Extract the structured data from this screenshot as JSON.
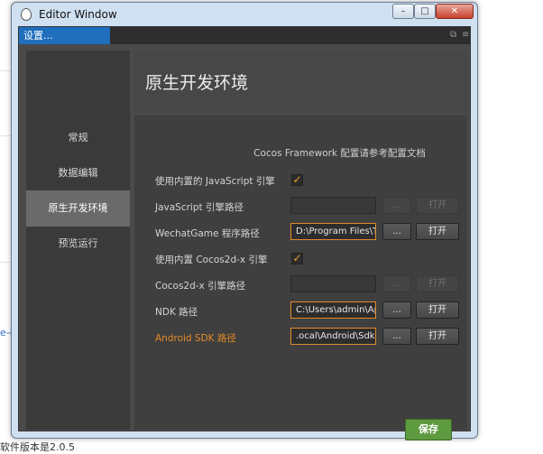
{
  "window": {
    "title": "Editor Window",
    "controls": {
      "minimize": "–",
      "maximize": "□",
      "close": "✕"
    }
  },
  "tab": {
    "label": "设置..."
  },
  "sidebar": {
    "items": [
      {
        "label": "常规",
        "active": false
      },
      {
        "label": "数据编辑",
        "active": false
      },
      {
        "label": "原生开发环境",
        "active": true
      },
      {
        "label": "预览运行",
        "active": false
      }
    ]
  },
  "main": {
    "title": "原生开发环境",
    "framework_note": "Cocos Framework 配置请参考配置文档",
    "rows": {
      "use_builtin_js": {
        "label": "使用内置的 JavaScript 引擎",
        "checked": true
      },
      "js_engine_path": {
        "label": "JavaScript 引擎路径",
        "value": ""
      },
      "wechat_path": {
        "label": "WechatGame 程序路径",
        "value": "D:\\Program Files\\Tencent"
      },
      "use_builtin_cocos2dx": {
        "label": "使用内置 Cocos2d-x 引擎",
        "checked": true
      },
      "cocos2dx_path": {
        "label": "Cocos2d-x 引擎路径",
        "value": ""
      },
      "ndk_path": {
        "label": "NDK 路径",
        "value": "C:\\Users\\admin\\AppData"
      },
      "android_sdk_path": {
        "label": "Android SDK 路径",
        "value": ".ocal\\Android\\Sdk"
      }
    },
    "browse_label": "...",
    "open_label": "打开",
    "save_label": "保存"
  },
  "background": {
    "partial_link": "e-de",
    "bottom_text": "软件版本是2.0.5"
  },
  "colors": {
    "accent_blue": "#1f6fbd",
    "warning_orange": "#e38a28",
    "save_green": "#5e9a3f",
    "check_orange": "#f1a02c"
  }
}
